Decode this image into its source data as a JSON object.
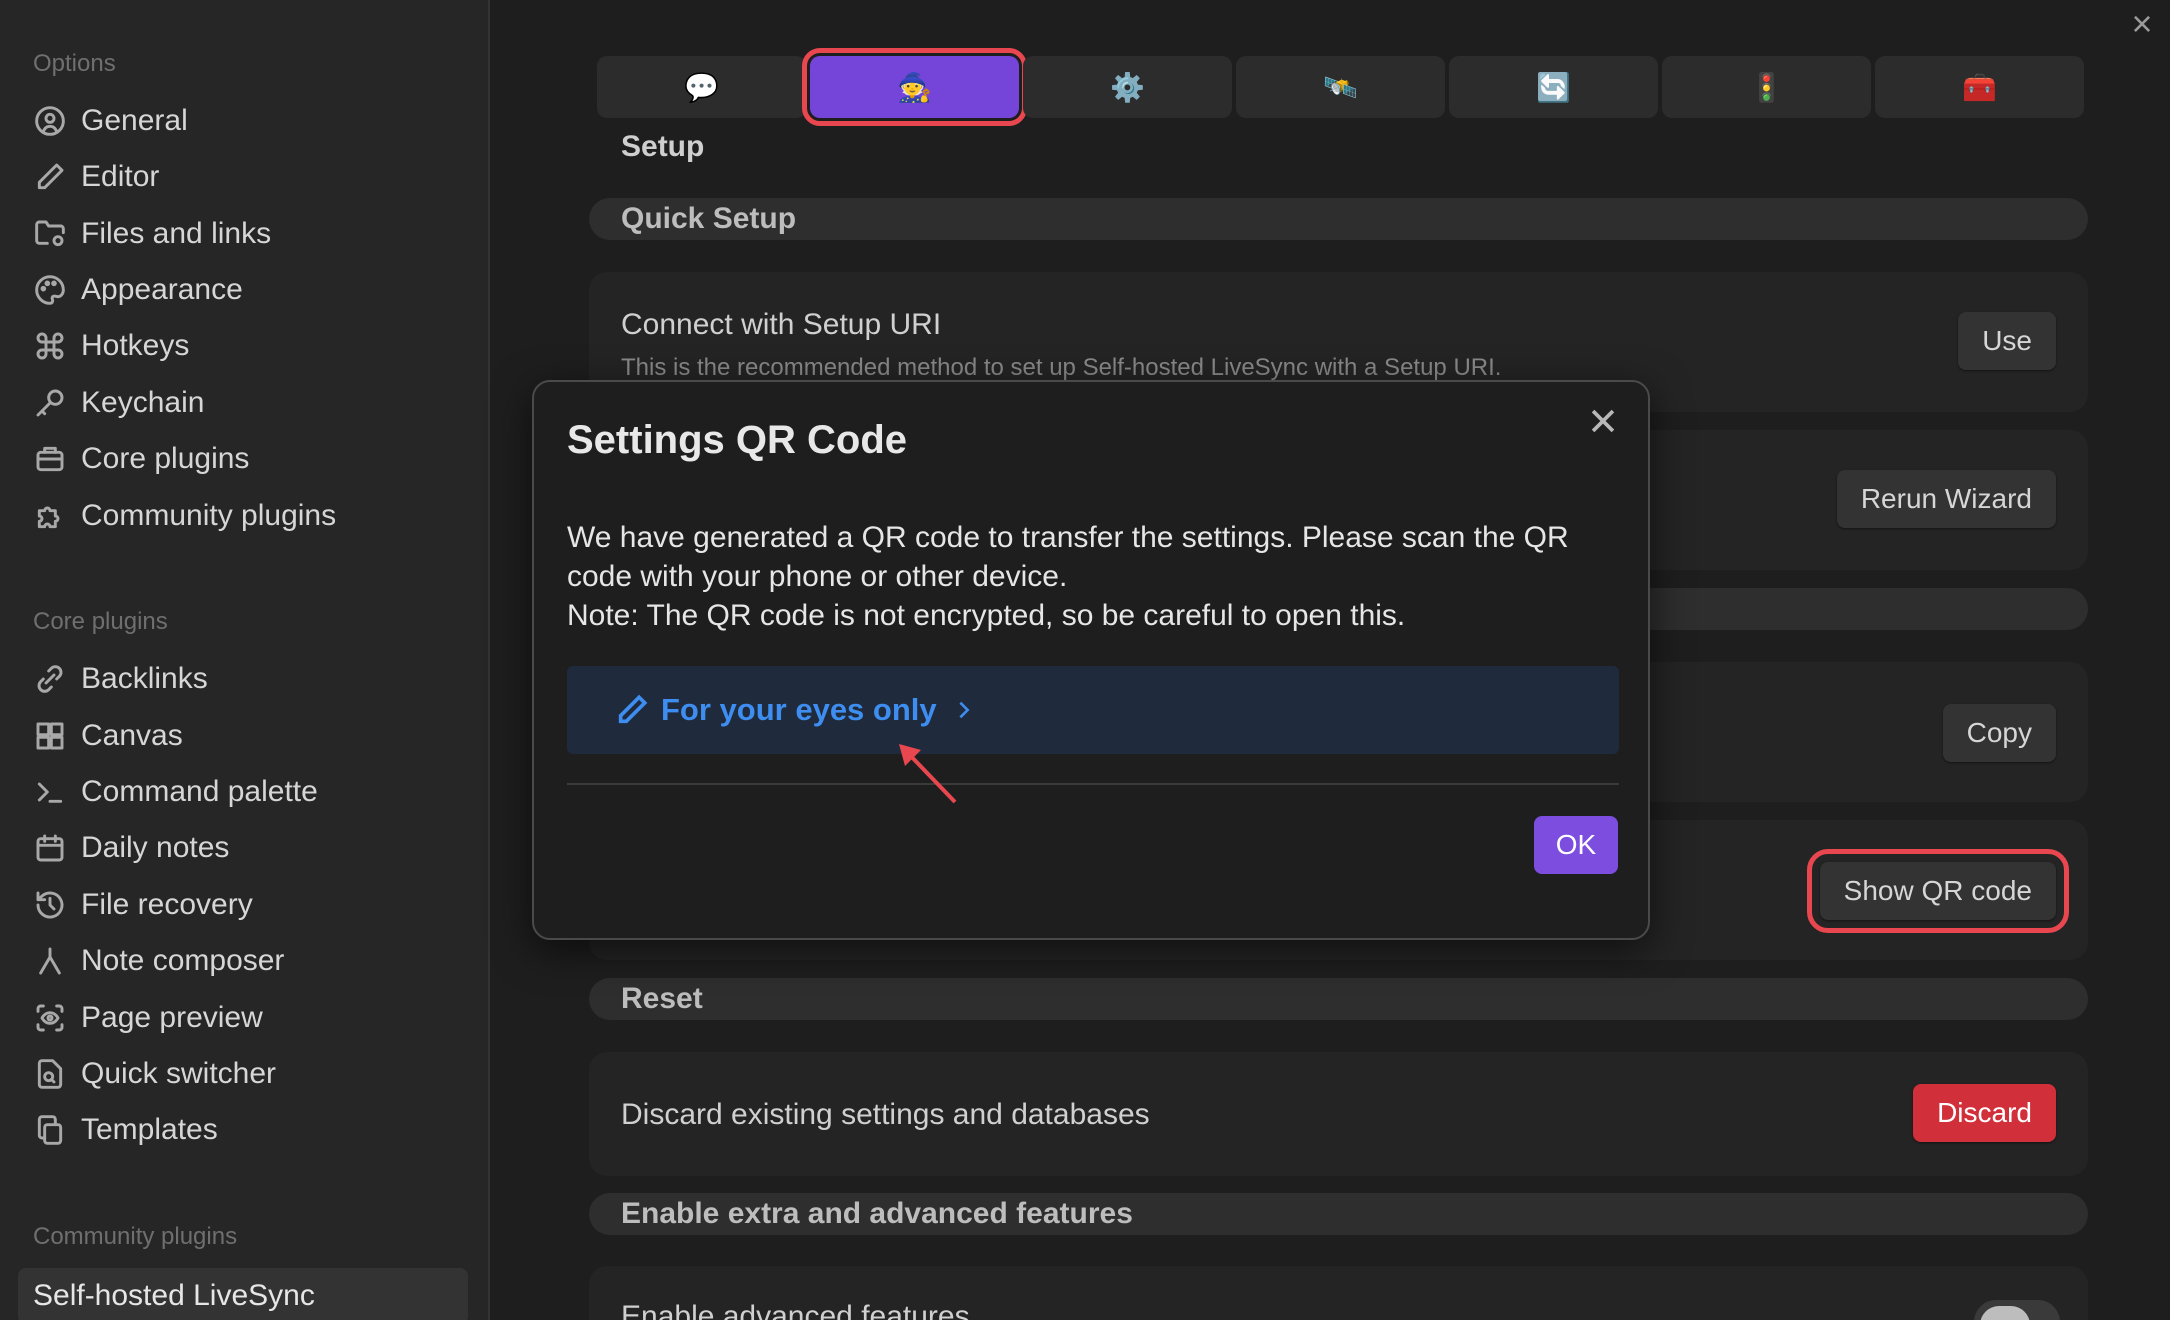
{
  "sidebar": {
    "options_title": "Options",
    "options": [
      {
        "label": "General",
        "icon": "user-circle-icon"
      },
      {
        "label": "Editor",
        "icon": "pencil-icon"
      },
      {
        "label": "Files and links",
        "icon": "folder-cog-icon"
      },
      {
        "label": "Appearance",
        "icon": "palette-icon"
      },
      {
        "label": "Hotkeys",
        "icon": "command-icon"
      },
      {
        "label": "Keychain",
        "icon": "key-icon"
      },
      {
        "label": "Core plugins",
        "icon": "briefcase-icon"
      },
      {
        "label": "Community plugins",
        "icon": "puzzle-icon"
      }
    ],
    "core_title": "Core plugins",
    "core": [
      {
        "label": "Backlinks",
        "icon": "backlinks-icon"
      },
      {
        "label": "Canvas",
        "icon": "canvas-icon"
      },
      {
        "label": "Command palette",
        "icon": "terminal-icon"
      },
      {
        "label": "Daily notes",
        "icon": "calendar-icon"
      },
      {
        "label": "File recovery",
        "icon": "history-icon"
      },
      {
        "label": "Note composer",
        "icon": "merge-icon"
      },
      {
        "label": "Page preview",
        "icon": "eye-scan-icon"
      },
      {
        "label": "Quick switcher",
        "icon": "file-search-icon"
      },
      {
        "label": "Templates",
        "icon": "copy-icon"
      }
    ],
    "community_title": "Community plugins",
    "active_item": "Self-hosted LiveSync"
  },
  "tabs": [
    {
      "emoji": "💬",
      "name": "tab-messages"
    },
    {
      "emoji": "🧙",
      "name": "tab-wizard"
    },
    {
      "emoji": "⚙️",
      "name": "tab-general-settings"
    },
    {
      "emoji": "🛰️",
      "name": "tab-remote"
    },
    {
      "emoji": "🔄",
      "name": "tab-sync"
    },
    {
      "emoji": "🚦",
      "name": "tab-selector"
    },
    {
      "emoji": "🧰",
      "name": "tab-hatch"
    }
  ],
  "main": {
    "setup_title": "Setup",
    "quick_setup": "Quick Setup",
    "connect_name": "Connect with Setup URI",
    "connect_desc": "This is the recommended method to set up Self-hosted LiveSync with a Setup URI.",
    "use_button": "Use",
    "rerun_button": "Rerun Wizard",
    "copy_button": "Copy",
    "show_qr_button": "Show QR code",
    "reset_title": "Reset",
    "discard_name": "Discard existing settings and databases",
    "discard_button": "Discard",
    "extra_title": "Enable extra and advanced features",
    "advanced_name": "Enable advanced features"
  },
  "modal": {
    "title": "Settings QR Code",
    "body_line1": "We have generated a QR code to transfer the settings. Please scan the QR code with your phone or other device.",
    "body_line2": "Note: The QR code is not encrypted, so be careful to open this.",
    "callout": "For your eyes only",
    "ok_button": "OK"
  },
  "colors": {
    "accent": "#7c4ddf",
    "highlight": "#e8474f",
    "danger": "#d12f39",
    "callout_text": "#3d8ef0"
  }
}
